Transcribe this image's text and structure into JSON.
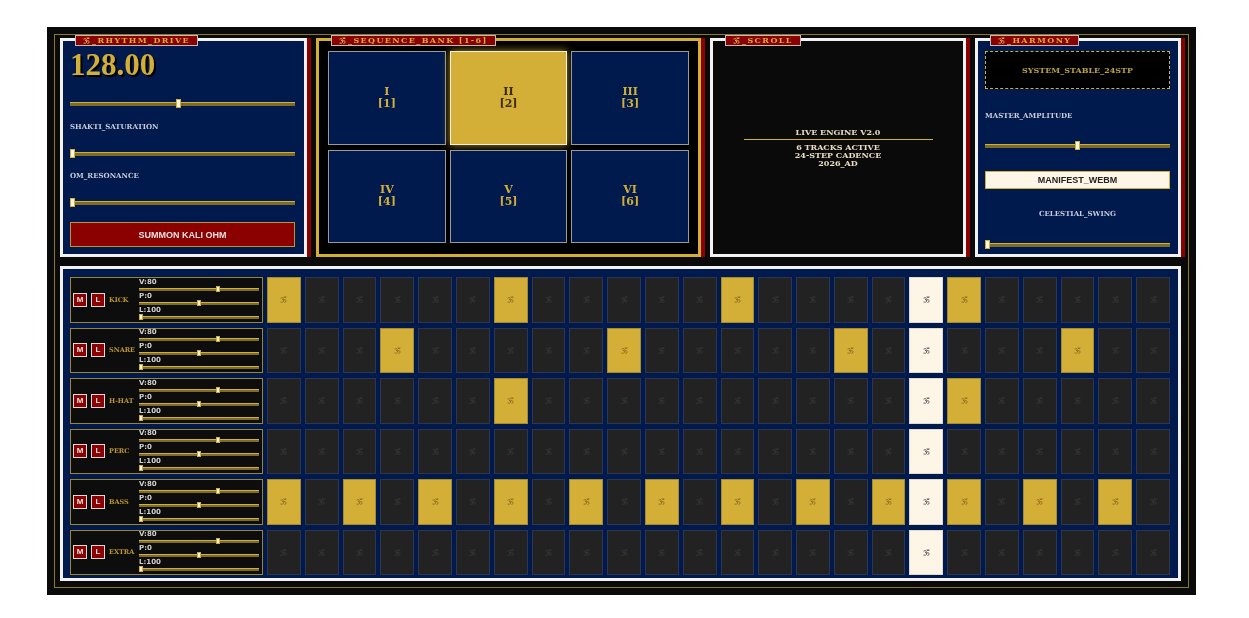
{
  "rhythm_drive": {
    "title": "_RHYTHM_DRIVE",
    "tempo": "128.00",
    "tempo_slider": {
      "level": 0.48
    },
    "controls": [
      {
        "label": "SHAKTI_SATURATION",
        "level": 0
      },
      {
        "label": "OM_RESONANCE",
        "level": 0
      }
    ],
    "button": "SUMMON KALI OHM"
  },
  "sequence_bank": {
    "title": "_SEQUENCE_BANK [1-6]",
    "banks": [
      {
        "numeral": "I",
        "index": "[1]",
        "selected": false
      },
      {
        "numeral": "II",
        "index": "[2]",
        "selected": true
      },
      {
        "numeral": "III",
        "index": "[3]",
        "selected": false
      },
      {
        "numeral": "IV",
        "index": "[4]",
        "selected": false
      },
      {
        "numeral": "V",
        "index": "[5]",
        "selected": false
      },
      {
        "numeral": "VI",
        "index": "[6]",
        "selected": false
      }
    ]
  },
  "scroll": {
    "title": "_SCROLL",
    "heading": "LIVE ENGINE V2.0",
    "lines": [
      "6 TRACKS ACTIVE",
      "24-STEP CADENCE",
      "2026_AD"
    ]
  },
  "harmony": {
    "title": "_HARMONY",
    "status": "SYSTEM_STABLE_24STP",
    "master_amplitude": {
      "label": "MASTER_AMPLITUDE",
      "level": 0.5
    },
    "button": "MANIFEST_WEBM",
    "celestial_swing": {
      "label": "CELESTIAL_SWING",
      "level": 0
    }
  },
  "tracks": [
    {
      "name": "KICK",
      "mute": "M",
      "loop": "L",
      "params": [
        {
          "label": "V:80",
          "level": 0.66
        },
        {
          "label": "P:0",
          "level": 0.5
        },
        {
          "label": "L:100",
          "level": 0
        }
      ],
      "steps": [
        {
          "on": true,
          "current": false
        },
        {
          "on": false,
          "current": false
        },
        {
          "on": false,
          "current": false
        },
        {
          "on": false,
          "current": false
        },
        {
          "on": false,
          "current": false
        },
        {
          "on": false,
          "current": false
        },
        {
          "on": true,
          "current": false
        },
        {
          "on": false,
          "current": false
        },
        {
          "on": false,
          "current": false
        },
        {
          "on": false,
          "current": false
        },
        {
          "on": false,
          "current": false
        },
        {
          "on": false,
          "current": false
        },
        {
          "on": true,
          "current": false
        },
        {
          "on": false,
          "current": false
        },
        {
          "on": false,
          "current": false
        },
        {
          "on": false,
          "current": false
        },
        {
          "on": false,
          "current": false
        },
        {
          "on": false,
          "current": true
        },
        {
          "on": true,
          "current": false
        },
        {
          "on": false,
          "current": false
        },
        {
          "on": false,
          "current": false
        },
        {
          "on": false,
          "current": false
        },
        {
          "on": false,
          "current": false
        },
        {
          "on": false,
          "current": false
        }
      ]
    },
    {
      "name": "SNARE",
      "mute": "M",
      "loop": "L",
      "params": [
        {
          "label": "V:80",
          "level": 0.66
        },
        {
          "label": "P:0",
          "level": 0.5
        },
        {
          "label": "L:100",
          "level": 0
        }
      ],
      "steps": [
        {
          "on": false,
          "current": false
        },
        {
          "on": false,
          "current": false
        },
        {
          "on": false,
          "current": false
        },
        {
          "on": true,
          "current": false
        },
        {
          "on": false,
          "current": false
        },
        {
          "on": false,
          "current": false
        },
        {
          "on": false,
          "current": false
        },
        {
          "on": false,
          "current": false
        },
        {
          "on": false,
          "current": false
        },
        {
          "on": true,
          "current": false
        },
        {
          "on": false,
          "current": false
        },
        {
          "on": false,
          "current": false
        },
        {
          "on": false,
          "current": false
        },
        {
          "on": false,
          "current": false
        },
        {
          "on": false,
          "current": false
        },
        {
          "on": true,
          "current": false
        },
        {
          "on": false,
          "current": false
        },
        {
          "on": false,
          "current": true
        },
        {
          "on": false,
          "current": false
        },
        {
          "on": false,
          "current": false
        },
        {
          "on": false,
          "current": false
        },
        {
          "on": true,
          "current": false
        },
        {
          "on": false,
          "current": false
        },
        {
          "on": false,
          "current": false
        }
      ]
    },
    {
      "name": "H-HAT",
      "mute": "M",
      "loop": "L",
      "params": [
        {
          "label": "V:80",
          "level": 0.66
        },
        {
          "label": "P:0",
          "level": 0.5
        },
        {
          "label": "L:100",
          "level": 0
        }
      ],
      "steps": [
        {
          "on": false,
          "current": false
        },
        {
          "on": false,
          "current": false
        },
        {
          "on": false,
          "current": false
        },
        {
          "on": false,
          "current": false
        },
        {
          "on": false,
          "current": false
        },
        {
          "on": false,
          "current": false
        },
        {
          "on": true,
          "current": false
        },
        {
          "on": false,
          "current": false
        },
        {
          "on": false,
          "current": false
        },
        {
          "on": false,
          "current": false
        },
        {
          "on": false,
          "current": false
        },
        {
          "on": false,
          "current": false
        },
        {
          "on": false,
          "current": false
        },
        {
          "on": false,
          "current": false
        },
        {
          "on": false,
          "current": false
        },
        {
          "on": false,
          "current": false
        },
        {
          "on": false,
          "current": false
        },
        {
          "on": false,
          "current": true
        },
        {
          "on": true,
          "current": false
        },
        {
          "on": false,
          "current": false
        },
        {
          "on": false,
          "current": false
        },
        {
          "on": false,
          "current": false
        },
        {
          "on": false,
          "current": false
        },
        {
          "on": false,
          "current": false
        }
      ]
    },
    {
      "name": "PERC",
      "mute": "M",
      "loop": "L",
      "params": [
        {
          "label": "V:80",
          "level": 0.66
        },
        {
          "label": "P:0",
          "level": 0.5
        },
        {
          "label": "L:100",
          "level": 0
        }
      ],
      "steps": [
        {
          "on": false,
          "current": false
        },
        {
          "on": false,
          "current": false
        },
        {
          "on": false,
          "current": false
        },
        {
          "on": false,
          "current": false
        },
        {
          "on": false,
          "current": false
        },
        {
          "on": false,
          "current": false
        },
        {
          "on": false,
          "current": false
        },
        {
          "on": false,
          "current": false
        },
        {
          "on": false,
          "current": false
        },
        {
          "on": false,
          "current": false
        },
        {
          "on": false,
          "current": false
        },
        {
          "on": false,
          "current": false
        },
        {
          "on": false,
          "current": false
        },
        {
          "on": false,
          "current": false
        },
        {
          "on": false,
          "current": false
        },
        {
          "on": false,
          "current": false
        },
        {
          "on": false,
          "current": false
        },
        {
          "on": false,
          "current": true
        },
        {
          "on": false,
          "current": false
        },
        {
          "on": false,
          "current": false
        },
        {
          "on": false,
          "current": false
        },
        {
          "on": false,
          "current": false
        },
        {
          "on": false,
          "current": false
        },
        {
          "on": false,
          "current": false
        }
      ]
    },
    {
      "name": "BASS",
      "mute": "M",
      "loop": "L",
      "params": [
        {
          "label": "V:80",
          "level": 0.66
        },
        {
          "label": "P:0",
          "level": 0.5
        },
        {
          "label": "L:100",
          "level": 0
        }
      ],
      "steps": [
        {
          "on": true,
          "current": false
        },
        {
          "on": false,
          "current": false
        },
        {
          "on": true,
          "current": false
        },
        {
          "on": false,
          "current": false
        },
        {
          "on": true,
          "current": false
        },
        {
          "on": false,
          "current": false
        },
        {
          "on": true,
          "current": false
        },
        {
          "on": false,
          "current": false
        },
        {
          "on": true,
          "current": false
        },
        {
          "on": false,
          "current": false
        },
        {
          "on": true,
          "current": false
        },
        {
          "on": false,
          "current": false
        },
        {
          "on": true,
          "current": false
        },
        {
          "on": false,
          "current": false
        },
        {
          "on": true,
          "current": false
        },
        {
          "on": false,
          "current": false
        },
        {
          "on": true,
          "current": false
        },
        {
          "on": false,
          "current": true
        },
        {
          "on": true,
          "current": false
        },
        {
          "on": false,
          "current": false
        },
        {
          "on": true,
          "current": false
        },
        {
          "on": false,
          "current": false
        },
        {
          "on": true,
          "current": false
        },
        {
          "on": false,
          "current": false
        }
      ]
    },
    {
      "name": "EXTRA",
      "mute": "M",
      "loop": "L",
      "params": [
        {
          "label": "V:80",
          "level": 0.66
        },
        {
          "label": "P:0",
          "level": 0.5
        },
        {
          "label": "L:100",
          "level": 0
        }
      ],
      "steps": [
        {
          "on": false,
          "current": false
        },
        {
          "on": false,
          "current": false
        },
        {
          "on": false,
          "current": false
        },
        {
          "on": false,
          "current": false
        },
        {
          "on": false,
          "current": false
        },
        {
          "on": false,
          "current": false
        },
        {
          "on": false,
          "current": false
        },
        {
          "on": false,
          "current": false
        },
        {
          "on": false,
          "current": false
        },
        {
          "on": false,
          "current": false
        },
        {
          "on": false,
          "current": false
        },
        {
          "on": false,
          "current": false
        },
        {
          "on": false,
          "current": false
        },
        {
          "on": false,
          "current": false
        },
        {
          "on": false,
          "current": false
        },
        {
          "on": false,
          "current": false
        },
        {
          "on": false,
          "current": false
        },
        {
          "on": false,
          "current": true
        },
        {
          "on": false,
          "current": false
        },
        {
          "on": false,
          "current": false
        },
        {
          "on": false,
          "current": false
        },
        {
          "on": false,
          "current": false
        },
        {
          "on": false,
          "current": false
        },
        {
          "on": false,
          "current": false
        }
      ]
    }
  ]
}
